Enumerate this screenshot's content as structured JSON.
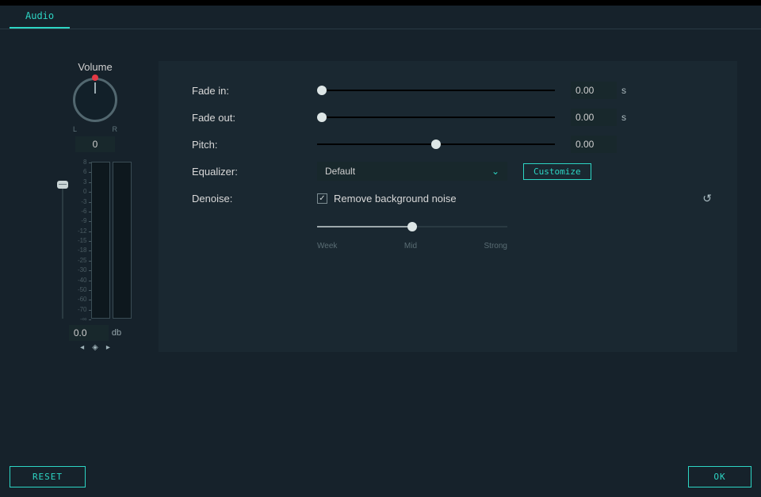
{
  "tabs": {
    "audio": "Audio"
  },
  "volume": {
    "title": "Volume",
    "left_label": "L",
    "right_label": "R",
    "pan_value": "0",
    "db_value": "0.0",
    "db_unit": "db",
    "scale_ticks": [
      "8",
      "6",
      "3",
      "0",
      "-3",
      "-6",
      "-9",
      "-12",
      "-15",
      "-18",
      "-25",
      "-30",
      "-40",
      "-50",
      "-60",
      "-70",
      "-∞"
    ]
  },
  "fade_in": {
    "label": "Fade in:",
    "value": "0.00",
    "unit": "s",
    "pos": 0
  },
  "fade_out": {
    "label": "Fade out:",
    "value": "0.00",
    "unit": "s",
    "pos": 0
  },
  "pitch": {
    "label": "Pitch:",
    "value": "0.00",
    "pos": 50
  },
  "equalizer": {
    "label": "Equalizer:",
    "selected": "Default",
    "customize": "Customize"
  },
  "denoise": {
    "label": "Denoise:",
    "checkbox_label": "Remove background noise",
    "checked": true,
    "pos": 50,
    "marks": {
      "weak": "Week",
      "mid": "Mid",
      "strong": "Strong"
    }
  },
  "footer": {
    "reset": "RESET",
    "ok": "OK"
  }
}
